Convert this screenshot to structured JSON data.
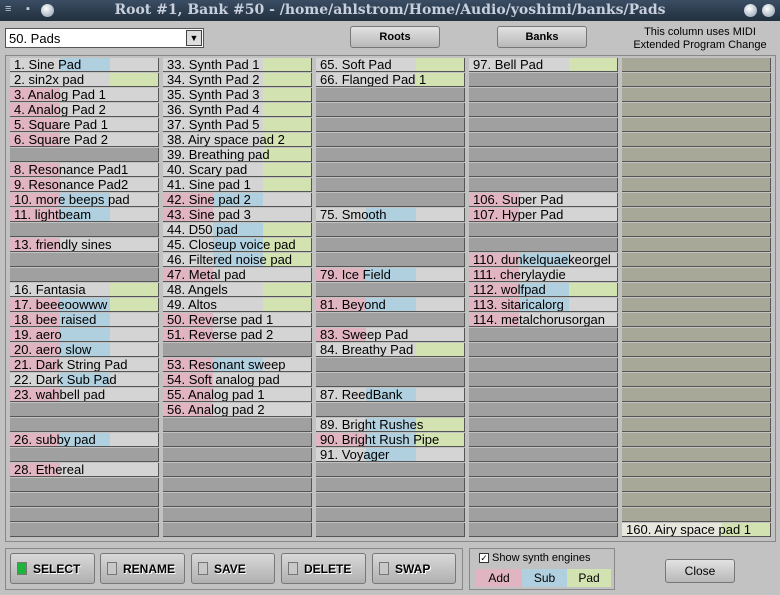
{
  "window": {
    "title": "Root #1, Bank #50 - /home/ahlstrom/Home/Audio/yoshimi/banks/Pads"
  },
  "bank_select": {
    "value": "50. Pads"
  },
  "buttons": {
    "roots": "Roots",
    "banks": "Banks",
    "close": "Close"
  },
  "note": {
    "line1": "This column uses MIDI",
    "line2": "Extended Program Change"
  },
  "colors": {
    "add": "#e0b4c0",
    "sub": "#b0d0e0",
    "pad": "#d2e2b0"
  },
  "actions": [
    {
      "label": "SELECT",
      "active": true
    },
    {
      "label": "RENAME",
      "active": false
    },
    {
      "label": "SAVE",
      "active": false
    },
    {
      "label": "DELETE",
      "active": false
    },
    {
      "label": "SWAP",
      "active": false
    }
  ],
  "engines": {
    "show_label": "Show synth engines",
    "checked": true,
    "add": "Add",
    "sub": "Sub",
    "pad": "Pad"
  },
  "instruments": {
    "1": [
      "Sine Pad",
      "S"
    ],
    "2": [
      "sin2x  pad",
      "P"
    ],
    "3": [
      "Analog Pad 1",
      "A"
    ],
    "4": [
      "Analog Pad 2",
      "A"
    ],
    "5": [
      "Square Pad 1",
      "A"
    ],
    "6": [
      "Square Pad 2",
      "A"
    ],
    "8": [
      "Resonance Pad1",
      "A"
    ],
    "9": [
      "Resonance Pad2",
      "A"
    ],
    "10": [
      "more beeps pad",
      "AS"
    ],
    "11": [
      "lightbeam",
      "AS"
    ],
    "13": [
      "friendly sines",
      "A"
    ],
    "16": [
      "Fantasia",
      "P"
    ],
    "17": [
      "beeeoowww",
      "ASP"
    ],
    "18": [
      "bee raised",
      "AS"
    ],
    "19": [
      "aero",
      "AS"
    ],
    "20": [
      "aero slow",
      "AS"
    ],
    "21": [
      "Dark  String  Pad",
      "A"
    ],
    "22": [
      "Dark  Sub  Pad",
      "S"
    ],
    "23": [
      "wahbell pad",
      "A"
    ],
    "26": [
      "subby pad",
      "AS"
    ],
    "28": [
      "Ethereal",
      "A"
    ],
    "33": [
      "Synth Pad 1",
      "P"
    ],
    "34": [
      "Synth Pad 2",
      "P"
    ],
    "35": [
      "Synth Pad 3",
      "P"
    ],
    "36": [
      "Synth Pad 4",
      "P"
    ],
    "37": [
      "Synth Pad 5",
      "P"
    ],
    "38": [
      "Airy space pad 2",
      "P"
    ],
    "39": [
      "Breathing pad",
      "P"
    ],
    "40": [
      "Scary pad",
      "P"
    ],
    "41": [
      "Sine pad 1",
      "P"
    ],
    "42": [
      "Sine pad 2",
      "AS"
    ],
    "43": [
      "Sine pad 3",
      "A"
    ],
    "44": [
      "D50 pad",
      "SP"
    ],
    "45": [
      "Closeup voice pad",
      "SP"
    ],
    "46": [
      "Filtered noise pad",
      "SP"
    ],
    "47": [
      "Metal pad",
      "A"
    ],
    "48": [
      "Angels",
      "P"
    ],
    "49": [
      "Altos",
      "P"
    ],
    "50": [
      "Reverse pad 1",
      "A"
    ],
    "51": [
      "Reverse pad 2",
      "A"
    ],
    "53": [
      "Resonant sweep",
      "AS"
    ],
    "54": [
      "Soft analog pad",
      "A"
    ],
    "55": [
      "Analog pad 1",
      "A"
    ],
    "56": [
      "Analog pad 2",
      "A"
    ],
    "65": [
      "Soft Pad",
      "P"
    ],
    "66": [
      "Flanged Pad 1",
      "P"
    ],
    "75": [
      "Smooth",
      "S"
    ],
    "79": [
      "Ice Field",
      "AS"
    ],
    "81": [
      "Beyond",
      "AS"
    ],
    "83": [
      "Sweep Pad",
      "A"
    ],
    "84": [
      "Breathy Pad",
      "P"
    ],
    "87": [
      "ReedBank",
      "S"
    ],
    "89": [
      "Bright Rushes",
      "SP"
    ],
    "90": [
      "Bright Rush Pipe",
      "ASP"
    ],
    "91": [
      "Voyager",
      "S"
    ],
    "97": [
      "Bell Pad",
      "P"
    ],
    "106": [
      "Super Pad",
      "A"
    ],
    "107": [
      "Hyper Pad",
      "A"
    ],
    "110": [
      "dunkelquaekeorgel",
      "AS"
    ],
    "111": [
      "cherylaydie",
      "A"
    ],
    "112": [
      "wolfpad",
      "ASP"
    ],
    "113": [
      "sitaricalorg",
      "AS"
    ],
    "114": [
      "metalchorusorgan",
      "A"
    ],
    "160": [
      "Airy space pad 1",
      "P"
    ]
  }
}
